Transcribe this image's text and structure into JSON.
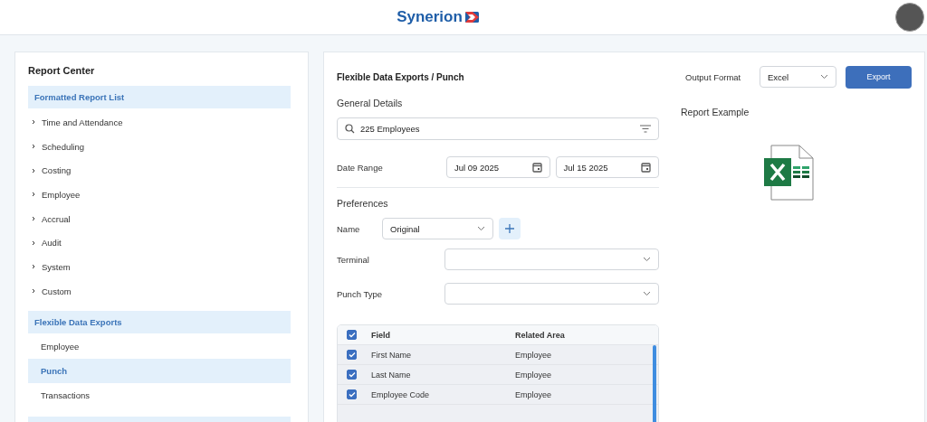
{
  "header": {
    "logo": "Synerion"
  },
  "sidebar": {
    "title": "Report Center",
    "sections": [
      {
        "label": "Formatted Report List",
        "items": [
          {
            "label": "Time and Attendance",
            "expanded": false,
            "selected": false
          },
          {
            "label": "Scheduling",
            "expanded": false,
            "selected": false
          },
          {
            "label": "Costing",
            "expanded": false,
            "selected": false
          },
          {
            "label": "Employee",
            "expanded": false,
            "selected": false
          },
          {
            "label": "Accrual",
            "expanded": false,
            "selected": false
          },
          {
            "label": "Audit",
            "expanded": false,
            "selected": false
          },
          {
            "label": "System",
            "expanded": false,
            "selected": false
          },
          {
            "label": "Custom",
            "expanded": false,
            "selected": false
          }
        ]
      },
      {
        "label": "Flexible Data Exports",
        "items": [
          {
            "label": "Employee",
            "selected": false
          },
          {
            "label": "Punch",
            "selected": true
          },
          {
            "label": "Transactions",
            "selected": false
          }
        ]
      }
    ]
  },
  "main": {
    "breadcrumb": "Flexible Data Exports / Punch",
    "output_format_label": "Output Format",
    "output_format": "Excel",
    "export_button": "Export",
    "general_details": "General Details",
    "employee_search": "225 Employees",
    "date_range_label": "Date Range",
    "date_from": "Jul 09 2025",
    "date_to": "Jul 15 2025",
    "preferences": "Preferences",
    "name_label": "Name",
    "name_value": "Original",
    "terminal_label": "Terminal",
    "punch_type_label": "Punch Type",
    "report_example": "Report Example",
    "table": {
      "all_checked": true,
      "columns": [
        "Field",
        "Related Area"
      ],
      "rows": [
        {
          "field": "First Name",
          "area": "Employee",
          "checked": true
        },
        {
          "field": "Last Name",
          "area": "Employee",
          "checked": true
        },
        {
          "field": "Employee Code",
          "area": "Employee",
          "checked": true
        }
      ]
    }
  }
}
